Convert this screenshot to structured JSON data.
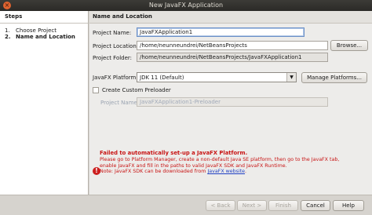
{
  "window": {
    "title": "New JavaFX Application"
  },
  "steps": {
    "header": "Steps",
    "items": [
      {
        "num": "1.",
        "label": "Choose Project"
      },
      {
        "num": "2.",
        "label": "Name and Location"
      }
    ]
  },
  "panel": {
    "header": "Name and Location",
    "project_name": {
      "label": "Project Name:",
      "value": "JavaFXApplication1"
    },
    "project_location": {
      "label": "Project Location:",
      "value": "/home/neunneundrei/NetBeansProjects",
      "browse_label": "Browse..."
    },
    "project_folder": {
      "label": "Project Folder:",
      "value": "/home/neunneundrei/NetBeansProjects/JavaFXApplication1"
    },
    "platform": {
      "label": "JavaFX Platform:",
      "value": "JDK 11 (Default)",
      "manage_label": "Manage Platforms..."
    },
    "preloader": {
      "checkbox_label": "Create Custom Preloader",
      "checked": false,
      "name_label": "Project Name:",
      "name_value": "JavaFXApplication1-Preloader"
    },
    "error": {
      "headline": "Failed to automatically set-up a JavaFX Platform.",
      "line1": "Please go to Platform Manager, create a non-default Java SE platform, then go to the JavaFX tab,",
      "line2": "enable JavaFX and fill in the paths to valid JavaFX SDK and JavaFX Runtime.",
      "line3_prefix": "Note: JavaFX SDK can be downloaded from ",
      "line3_link": "JavaFX website",
      "line3_suffix": "."
    }
  },
  "footer": {
    "back": "< Back",
    "next": "Next >",
    "finish": "Finish",
    "cancel": "Cancel",
    "help": "Help"
  },
  "colors": {
    "error": "#c81414",
    "link": "#1f3fc4",
    "titlebar": "#3c3b37"
  }
}
